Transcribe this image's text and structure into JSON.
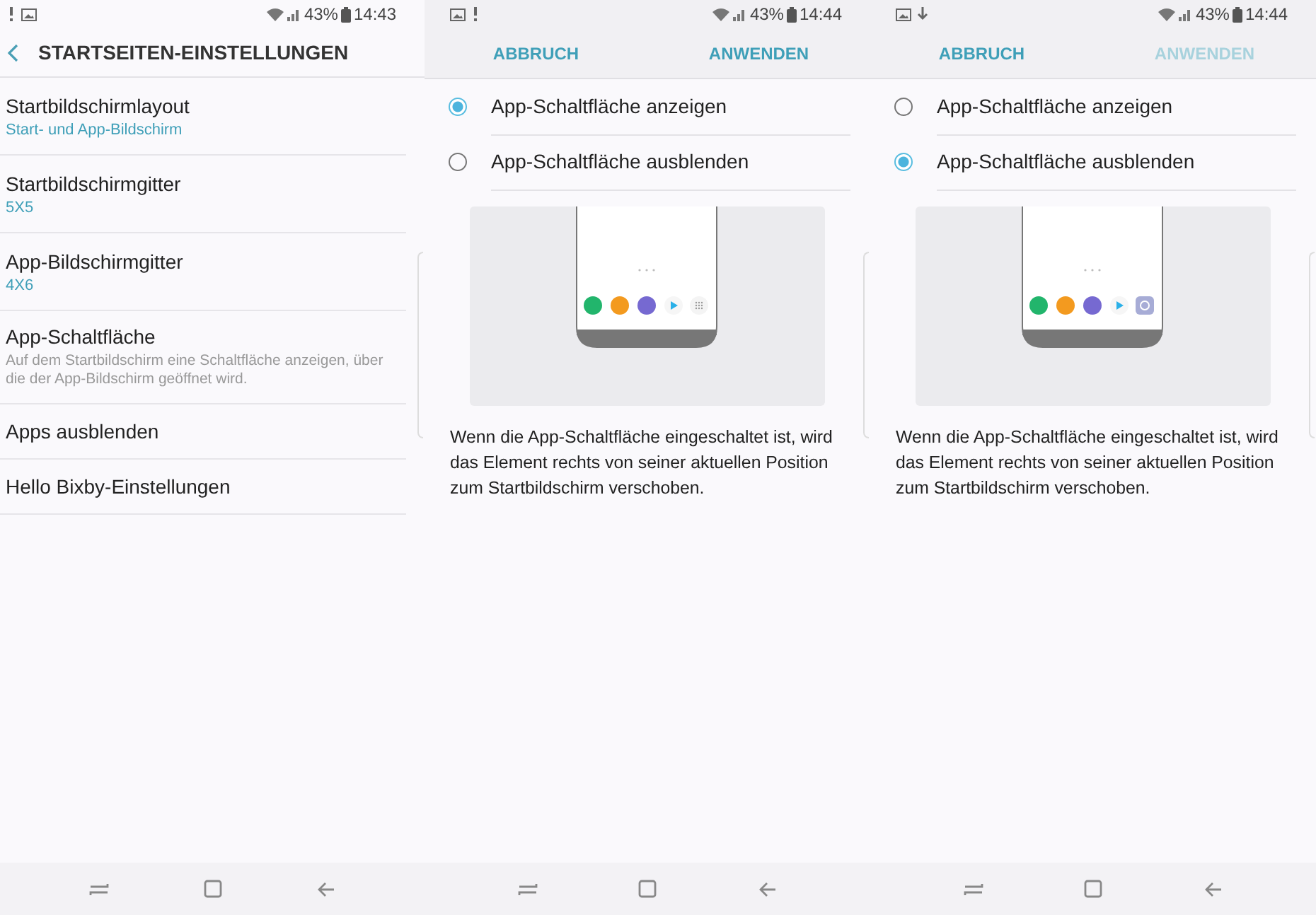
{
  "screens": [
    {
      "kind": "settings",
      "status": {
        "notifications": [
          {
            "kind": "alert"
          },
          {
            "kind": "image"
          }
        ],
        "battery": "43%",
        "time": "14:43"
      },
      "title": "STARTSEITEN-EINSTELLUNGEN",
      "items": [
        {
          "title": "Startbildschirmlayout",
          "subtitle": "Start- und App-Bildschirm",
          "kind": "value"
        },
        {
          "title": "Startbildschirmgitter",
          "subtitle": "5X5",
          "kind": "value"
        },
        {
          "title": "App-Bildschirmgitter",
          "subtitle": "4X6",
          "kind": "value"
        },
        {
          "title": "App-Schaltfläche",
          "subtitle": "Auf dem Startbildschirm eine Schaltfläche anzeigen, über die der App-Bildschirm geöffnet wird.",
          "kind": "hint"
        },
        {
          "title": "Apps ausblenden"
        },
        {
          "title": "Hello Bixby-Einstellungen"
        }
      ]
    },
    {
      "kind": "dialog",
      "status": {
        "notifications": [
          {
            "kind": "image"
          },
          {
            "kind": "alert"
          }
        ],
        "battery": "43%",
        "time": "14:44"
      },
      "cancel": "ABBRUCH",
      "apply": {
        "label": "ANWENDEN",
        "disabled": false
      },
      "options": [
        {
          "label": "App-Schaltfläche anzeigen",
          "selected": true
        },
        {
          "label": "App-Schaltfläche ausblenden",
          "selected": false
        }
      ],
      "preview": {
        "kind": "grid"
      },
      "description": "Wenn die App-Schaltfläche eingeschaltet ist, wird das Element rechts von seiner aktuellen Position zum Startbildschirm verschoben."
    },
    {
      "kind": "dialog",
      "status": {
        "notifications": [
          {
            "kind": "image"
          },
          {
            "kind": "download"
          }
        ],
        "battery": "43%",
        "time": "14:44"
      },
      "cancel": "ABBRUCH",
      "apply": {
        "label": "ANWENDEN",
        "disabled": true
      },
      "options": [
        {
          "label": "App-Schaltfläche anzeigen",
          "selected": false
        },
        {
          "label": "App-Schaltfläche ausblenden",
          "selected": true
        }
      ],
      "preview": {
        "kind": "camera"
      },
      "description": "Wenn die App-Schaltfläche eingeschaltet ist, wird das Element rechts von seiner aktuellen Position zum Startbildschirm verschoben."
    }
  ]
}
